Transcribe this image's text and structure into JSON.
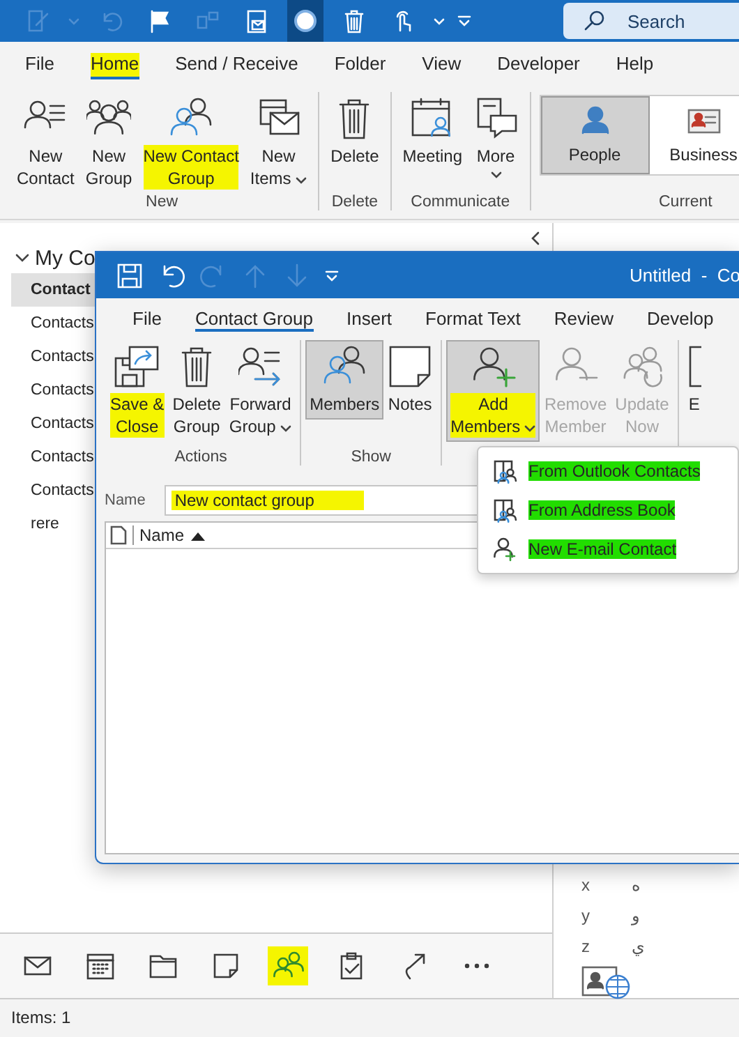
{
  "titlebar": {
    "search": {
      "placeholder": "Search"
    }
  },
  "tabs": [
    {
      "label": "File",
      "selected": false,
      "highlighted": false
    },
    {
      "label": "Home",
      "selected": true,
      "highlighted": true
    },
    {
      "label": "Send / Receive",
      "selected": false,
      "highlighted": false
    },
    {
      "label": "Folder",
      "selected": false,
      "highlighted": false
    },
    {
      "label": "View",
      "selected": false,
      "highlighted": false
    },
    {
      "label": "Developer",
      "selected": false,
      "highlighted": false
    },
    {
      "label": "Help",
      "selected": false,
      "highlighted": false
    }
  ],
  "ribbon": {
    "groups": [
      {
        "label": "New",
        "buttons": [
          {
            "label": "New\nContact",
            "dropdown": false,
            "highlighted": false
          },
          {
            "label": "New\nGroup",
            "dropdown": false,
            "highlighted": false
          },
          {
            "label": "New Contact\nGroup",
            "dropdown": false,
            "highlighted": true
          },
          {
            "label": "New\nItems",
            "dropdown": true,
            "highlighted": false
          }
        ]
      },
      {
        "label": "Delete",
        "buttons": [
          {
            "label": "Delete",
            "dropdown": false,
            "highlighted": false
          }
        ]
      },
      {
        "label": "Communicate",
        "buttons": [
          {
            "label": "Meeting",
            "dropdown": false,
            "highlighted": false
          },
          {
            "label": "More",
            "dropdown": true,
            "highlighted": false
          }
        ]
      }
    ],
    "current_view": {
      "label": "Current",
      "views": [
        {
          "label": "People",
          "selected": true
        },
        {
          "label": "Business",
          "selected": false
        }
      ]
    }
  },
  "folders": {
    "header": {
      "label": "My Co",
      "expanded": true
    },
    "items": [
      {
        "label": "Contact",
        "selected": true
      },
      {
        "label": "Contacts",
        "selected": false
      },
      {
        "label": "Contacts",
        "selected": false
      },
      {
        "label": "Contacts",
        "selected": false
      },
      {
        "label": "Contacts",
        "selected": false
      },
      {
        "label": "Contacts",
        "selected": false
      },
      {
        "label": "Contacts",
        "selected": false
      },
      {
        "label": "rere",
        "selected": false
      }
    ]
  },
  "index": [
    {
      "latin": "x",
      "arabic": "ه"
    },
    {
      "latin": "y",
      "arabic": "و"
    },
    {
      "latin": "z",
      "arabic": "ي"
    }
  ],
  "nav": [
    {
      "selected": false,
      "highlighted": false
    },
    {
      "selected": false,
      "highlighted": false
    },
    {
      "selected": false,
      "highlighted": false
    },
    {
      "selected": false,
      "highlighted": false
    },
    {
      "selected": true,
      "highlighted": true
    },
    {
      "selected": false,
      "highlighted": false
    },
    {
      "selected": false,
      "highlighted": false
    },
    {
      "selected": false,
      "highlighted": false
    }
  ],
  "status_bar": {
    "text": "Items: 1"
  },
  "dialog": {
    "title": "Untitled  -  Co",
    "tabs": [
      {
        "label": "File",
        "selected": false
      },
      {
        "label": "Contact Group",
        "selected": true
      },
      {
        "label": "Insert",
        "selected": false
      },
      {
        "label": "Format Text",
        "selected": false
      },
      {
        "label": "Review",
        "selected": false
      },
      {
        "label": "Develop",
        "selected": false
      }
    ],
    "groups": [
      {
        "label": "Actions",
        "buttons": [
          {
            "label": "Save &\nClose",
            "dropdown": false,
            "highlighted": true,
            "selected": false,
            "disabled": false
          },
          {
            "label": "Delete\nGroup",
            "dropdown": false,
            "highlighted": false,
            "selected": false,
            "disabled": false
          },
          {
            "label": "Forward\nGroup",
            "dropdown": true,
            "highlighted": false,
            "selected": false,
            "disabled": false
          }
        ]
      },
      {
        "label": "Show",
        "buttons": [
          {
            "label": "Members",
            "dropdown": false,
            "highlighted": false,
            "selected": true,
            "disabled": false
          },
          {
            "label": "Notes",
            "dropdown": false,
            "highlighted": false,
            "selected": false,
            "disabled": false
          }
        ]
      },
      {
        "buttons": [
          {
            "label": "Add\nMembers",
            "dropdown": true,
            "highlighted": true,
            "selected": true,
            "disabled": false
          },
          {
            "label": "Remove\nMember",
            "dropdown": false,
            "highlighted": false,
            "selected": false,
            "disabled": true
          },
          {
            "label": "Update\nNow",
            "dropdown": false,
            "highlighted": false,
            "selected": false,
            "disabled": true
          }
        ]
      },
      {
        "buttons": [
          {
            "label": "E",
            "dropdown": false,
            "highlighted": false,
            "selected": false,
            "disabled": false
          }
        ]
      }
    ],
    "name_field": {
      "label": "Name",
      "value": "New contact group",
      "highlighted": true
    },
    "table": {
      "columns": [
        {
          "label": "Name",
          "sorted": true
        }
      ]
    }
  },
  "menu": {
    "items": [
      {
        "label": "From Outlook Contacts",
        "highlighted": true
      },
      {
        "label": "From Address Book",
        "highlighted": true
      },
      {
        "label": "New E-mail Contact",
        "highlighted": true
      }
    ]
  }
}
